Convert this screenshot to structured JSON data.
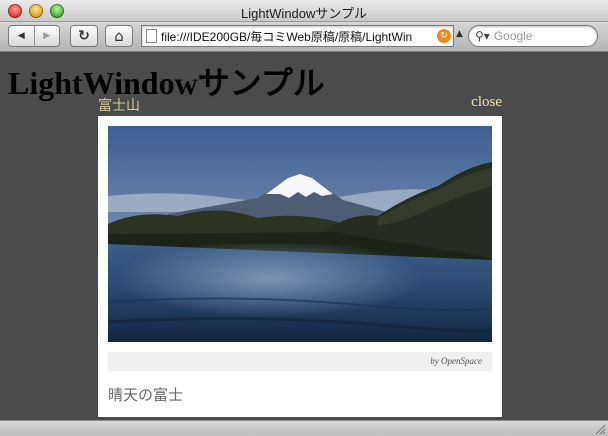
{
  "window": {
    "title": "LightWindowサンプル"
  },
  "toolbar": {
    "back_icon": "◀",
    "forward_icon": "▶",
    "reload_icon": "↻",
    "home_icon": "⌂",
    "url": "file:///IDE200GB/毎コミWeb原稿/原稿/LightWin",
    "search_placeholder": "Google"
  },
  "page": {
    "title": "LightWindowサンプル"
  },
  "lightwindow": {
    "caption": "富士山",
    "close_label": "close",
    "credit": "by OpenSpace",
    "description": "晴天の富士"
  },
  "colors": {
    "page_background": "#4b4b4b",
    "caption": "#d4c99a",
    "close": "#ede3b6",
    "rss_orange": "#f08a1e"
  }
}
